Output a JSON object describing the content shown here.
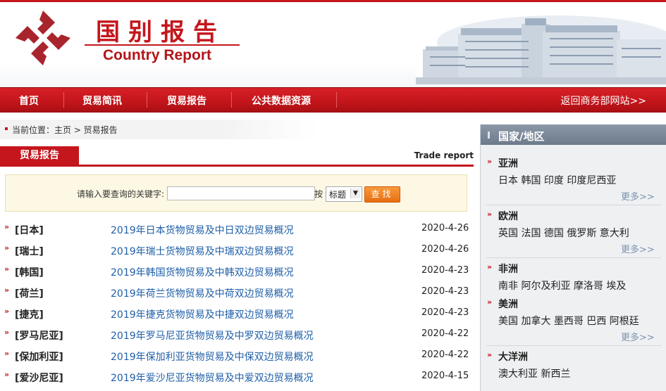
{
  "header": {
    "title_cn": "国别报告",
    "title_en": "Country Report"
  },
  "nav": {
    "items": [
      {
        "label": "首页"
      },
      {
        "label": "贸易简讯"
      },
      {
        "label": "贸易报告"
      },
      {
        "label": "公共数据资源"
      }
    ],
    "return_link": "返回商务部网站>>"
  },
  "breadcrumb": {
    "text": "当前位置：主页 > 贸易报告"
  },
  "section": {
    "tab_label": "贸易报告",
    "en_label": "Trade report"
  },
  "search": {
    "label": "请输入要查询的关键字:",
    "input_value": "",
    "by_label": "按",
    "field_selected": "标题",
    "button_label": "查找"
  },
  "reports": [
    {
      "country": "[日本]",
      "title": "2019年日本货物贸易及中日双边贸易概况",
      "date": "2020-4-26"
    },
    {
      "country": "[瑞士]",
      "title": "2019年瑞士货物贸易及中瑞双边贸易概况",
      "date": "2020-4-26"
    },
    {
      "country": "[韩国]",
      "title": "2019年韩国货物贸易及中韩双边贸易概况",
      "date": "2020-4-23"
    },
    {
      "country": "[荷兰]",
      "title": "2019年荷兰货物贸易及中荷双边贸易概况",
      "date": "2020-4-23"
    },
    {
      "country": "[捷克]",
      "title": "2019年捷克货物贸易及中捷双边贸易概况",
      "date": "2020-4-23"
    },
    {
      "country": "[罗马尼亚]",
      "title": "2019年罗马尼亚货物贸易及中罗双边贸易概况",
      "date": "2020-4-22"
    },
    {
      "country": "[保加利亚]",
      "title": "2019年保加利亚货物贸易及中保双边贸易概况",
      "date": "2020-4-22"
    },
    {
      "country": "[爱沙尼亚]",
      "title": "2019年爱沙尼亚货物贸易及中爱双边贸易概况",
      "date": "2020-4-15"
    }
  ],
  "sidebar": {
    "title": "国家/地区",
    "regions": [
      {
        "name": "亚洲",
        "countries": "日本 韩国 印度 印度尼西亚",
        "more": "更多>>"
      },
      {
        "name": "欧洲",
        "countries": "英国 法国 德国 俄罗斯 意大利",
        "more": "更多>>"
      },
      {
        "name": "非洲",
        "countries": "南非 阿尔及利亚 摩洛哥 埃及",
        "more": ""
      },
      {
        "name": "美洲",
        "countries": "美国 加拿大 墨西哥 巴西 阿根廷",
        "more": "更多>>"
      },
      {
        "name": "大洋洲",
        "countries": "澳大利亚 新西兰",
        "more": ""
      }
    ]
  },
  "colors": {
    "brand_red": "#c4161c",
    "link_blue": "#1f5fa8",
    "more_blue": "#7c93b2",
    "search_button_orange": "#e86e10"
  }
}
